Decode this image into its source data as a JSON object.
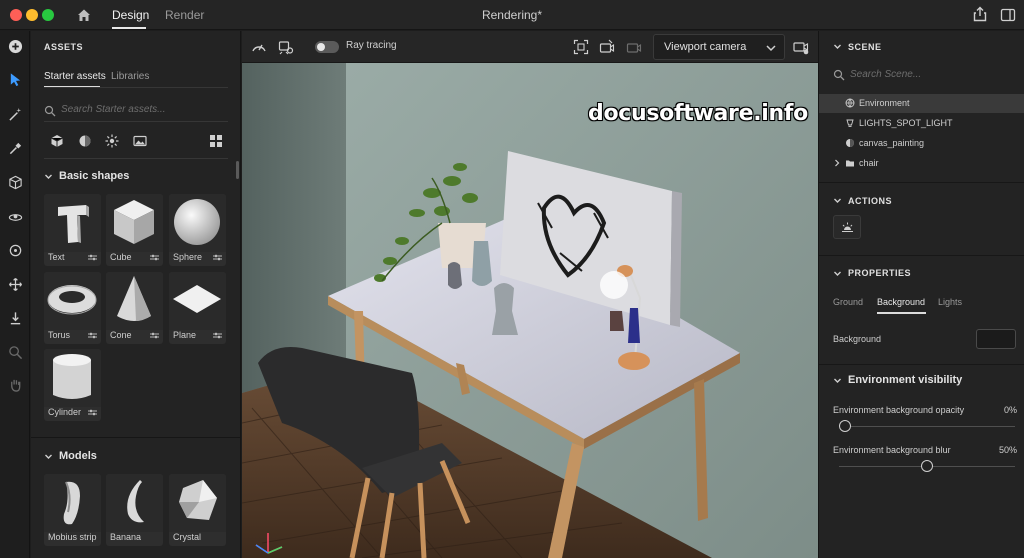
{
  "titlebar": {
    "tabs": [
      {
        "label": "Design",
        "active": true
      },
      {
        "label": "Render",
        "active": false
      }
    ],
    "document_title": "Rendering*"
  },
  "assets": {
    "header": "ASSETS",
    "tabs": [
      {
        "label": "Starter assets",
        "active": true
      },
      {
        "label": "Libraries",
        "active": false
      }
    ],
    "search_placeholder": "Search Starter assets...",
    "sections": [
      {
        "title": "Basic shapes",
        "items": [
          "Text",
          "Cube",
          "Sphere",
          "Torus",
          "Cone",
          "Plane",
          "Cylinder"
        ]
      },
      {
        "title": "Models",
        "items": [
          "Mobius strip",
          "Banana",
          "Crystal"
        ]
      }
    ]
  },
  "viewport": {
    "ray_tracing_label": "Ray tracing",
    "ray_tracing_on": true,
    "camera_select": "Viewport camera",
    "watermark": "docusoftware.info"
  },
  "scene": {
    "header": "SCENE",
    "search_placeholder": "Search Scene...",
    "items": [
      {
        "label": "Environment",
        "icon": "globe-icon",
        "selected": true
      },
      {
        "label": "LIGHTS_SPOT_LIGHT",
        "icon": "light-icon",
        "selected": false
      },
      {
        "label": "canvas_painting",
        "icon": "material-icon",
        "selected": false
      },
      {
        "label": "chair",
        "icon": "folder-icon",
        "selected": false,
        "expandable": true
      }
    ]
  },
  "actions": {
    "header": "ACTIONS"
  },
  "properties": {
    "header": "PROPERTIES",
    "tabs": [
      {
        "label": "Ground",
        "active": false
      },
      {
        "label": "Background",
        "active": true
      },
      {
        "label": "Lights",
        "active": false
      }
    ],
    "background_label": "Background",
    "background_color": "#1b1b1b",
    "env_visibility": {
      "title": "Environment visibility",
      "opacity_label": "Environment background opacity",
      "opacity_value": "0%",
      "opacity_fraction": 0.0,
      "blur_label": "Environment background blur",
      "blur_value": "50%",
      "blur_fraction": 0.5
    }
  }
}
